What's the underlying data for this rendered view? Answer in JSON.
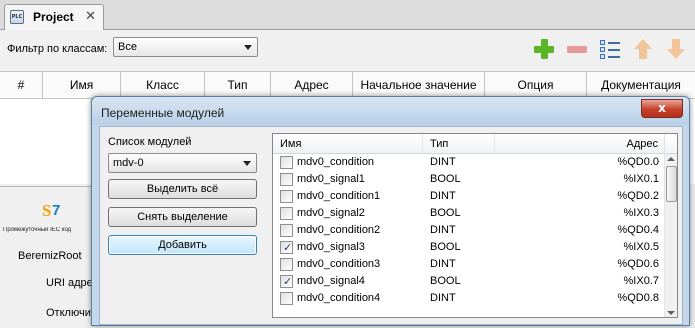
{
  "tab": {
    "icon_text": "PLC",
    "title": "Project",
    "close": "✕"
  },
  "filter": {
    "label": "Фильтр по классам:",
    "value": "Все"
  },
  "toolbar": {
    "icons": [
      "add-icon",
      "remove-icon",
      "list-icon",
      "up-arrow-icon",
      "down-arrow-icon"
    ]
  },
  "grid": {
    "columns": [
      "#",
      "Имя",
      "Класс",
      "Тип",
      "Адрес",
      "Начальное значение",
      "Опция",
      "Документация"
    ]
  },
  "lower_panel": {
    "iec_label": "Промежуточный IEC код",
    "root": "BeremizRoot",
    "uri": "URI адрес",
    "disable": "Отключить"
  },
  "dialog": {
    "title": "Переменные модулей",
    "close": "x",
    "modules_label": "Список модулей",
    "module_value": "mdv-0",
    "select_all": "Выделить всё",
    "deselect": "Снять выделение",
    "add": "Добавить",
    "table": {
      "headers": {
        "name": "Имя",
        "type": "Тип",
        "address": "Адрес"
      },
      "rows": [
        {
          "name": "mdv0_condition",
          "type": "DINT",
          "address": "%QD0.0",
          "checked": false
        },
        {
          "name": "mdv0_signal1",
          "type": "BOOL",
          "address": "%IX0.1",
          "checked": false
        },
        {
          "name": "mdv0_condition1",
          "type": "DINT",
          "address": "%QD0.2",
          "checked": false
        },
        {
          "name": "mdv0_signal2",
          "type": "BOOL",
          "address": "%IX0.3",
          "checked": false
        },
        {
          "name": "mdv0_condition2",
          "type": "DINT",
          "address": "%QD0.4",
          "checked": false
        },
        {
          "name": "mdv0_signal3",
          "type": "BOOL",
          "address": "%IX0.5",
          "checked": true
        },
        {
          "name": "mdv0_condition3",
          "type": "DINT",
          "address": "%QD0.6",
          "checked": false
        },
        {
          "name": "mdv0_signal4",
          "type": "BOOL",
          "address": "%IX0.7",
          "checked": true
        },
        {
          "name": "mdv0_condition4",
          "type": "DINT",
          "address": "%QD0.8",
          "checked": false
        }
      ]
    }
  },
  "colors": {
    "dialog_frame": "#c4d7ea",
    "close_button": "#c7402a",
    "add_icon": "#5cb526",
    "remove_icon": "#e79a9a",
    "arrow_icons": "#f2c49a"
  }
}
